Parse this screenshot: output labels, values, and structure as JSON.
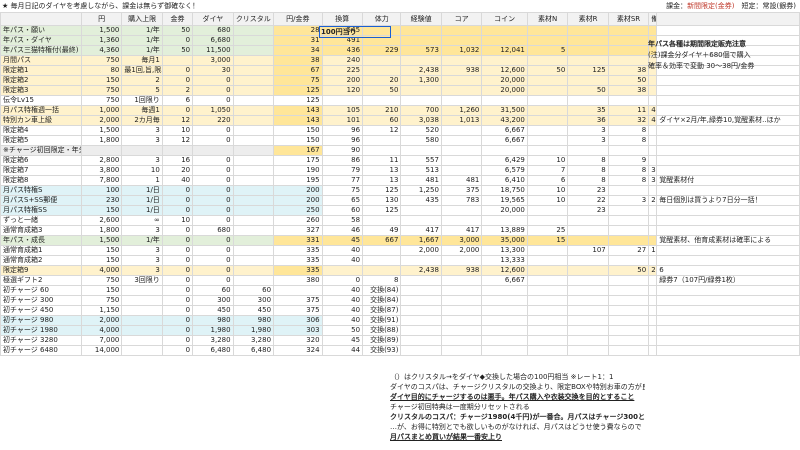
{
  "topbar": {
    "title": "★ 毎月日記のダイヤを考慮しながら、課金は無らず御確なく！",
    "right_prefix": "課金：",
    "right_mid": "新間限定(金券)",
    "right_suffix": "　短定：常設(銀券)"
  },
  "cell_b100": "100円当り",
  "headers": [
    "",
    "円",
    "購入上限",
    "金券",
    "ダイヤ",
    "クリスタル",
    "円/金券",
    "換算",
    "体力",
    "経験値",
    "コア",
    "コイン",
    "素材N",
    "素材R",
    "素材SR",
    "備考"
  ],
  "rows": [
    {
      "cells": [
        "年パス・願い",
        "1,500",
        "1/年",
        "50",
        "680",
        "",
        "28",
        "545",
        "",
        "",
        "",
        "",
        "",
        "",
        "",
        "",
        ""
      ],
      "cls": "g"
    },
    {
      "cells": [
        "年パス・ダイヤ",
        "1,360",
        "1/年",
        "0",
        "6,680",
        "",
        "31",
        "491",
        "",
        "",
        "",
        "",
        "",
        "",
        "",
        "",
        ""
      ],
      "cls": "g"
    },
    {
      "cells": [
        "年パス三猫特権付(最終)",
        "4,360",
        "1/年",
        "50",
        "11,500",
        "",
        "34",
        "436",
        "229",
        "573",
        "1,032",
        "12,041",
        "5",
        "",
        "",
        "",
        ""
      ],
      "cls": "g"
    },
    {
      "cells": [
        "月間パス",
        "750",
        "毎月1",
        "",
        "3,000",
        "",
        "38",
        "240",
        "",
        "",
        "",
        "",
        "",
        "",
        "",
        "",
        ""
      ],
      "cls": "y"
    },
    {
      "cells": [
        "限定箱1",
        "80",
        "最1回,旨,限5",
        "0",
        "30",
        "",
        "67",
        "225",
        "",
        "2,438",
        "938",
        "12,600",
        "50",
        "125",
        "38",
        "",
        ""
      ],
      "cls": "y"
    },
    {
      "cells": [
        "限定箱2",
        "150",
        "2",
        "0",
        "0",
        "",
        "75",
        "200",
        "20",
        "1,300",
        "",
        "20,000",
        "",
        "",
        "50",
        "",
        ""
      ],
      "cls": "y"
    },
    {
      "cells": [
        "限定箱3",
        "750",
        "5",
        "2",
        "0",
        "",
        "125",
        "120",
        "50",
        "",
        "",
        "20,000",
        "",
        "50",
        "38",
        "",
        ""
      ],
      "cls": "y"
    },
    {
      "cells": [
        "伝令Lv15",
        "750",
        "1回限り",
        "6",
        "0",
        "",
        "125",
        "",
        "",
        "",
        "",
        "",
        "",
        "",
        "",
        "",
        ""
      ],
      "cls": ""
    },
    {
      "cells": [
        "月パス特権週一括",
        "1,000",
        "毎週1",
        "0",
        "1,050",
        "",
        "143",
        "105",
        "210",
        "700",
        "1,260",
        "31,500",
        "",
        "35",
        "11",
        "4",
        ""
      ],
      "cls": "y"
    },
    {
      "cells": [
        "特別カン車上級",
        "2,000",
        "2カ月毎",
        "12",
        "220",
        "",
        "143",
        "101",
        "60",
        "3,038",
        "1,013",
        "43,200",
        "",
        "36",
        "32",
        "47",
        "ダイヤ×2月/年,緑券10,覚醒素材..ほか"
      ],
      "cls": "y"
    },
    {
      "cells": [
        "限定箱4",
        "1,500",
        "3",
        "10",
        "0",
        "",
        "150",
        "96",
        "12",
        "520",
        "",
        "6,667",
        "",
        "3",
        "8",
        "",
        ""
      ],
      "cls": ""
    },
    {
      "cells": [
        "限定箱5",
        "1,800",
        "3",
        "12",
        "0",
        "",
        "150",
        "96",
        "",
        "580",
        "",
        "6,667",
        "",
        "3",
        "8",
        "",
        ""
      ],
      "cls": ""
    },
    {
      "cells": [
        "※チャージ初回限定・年分で獲得",
        "",
        "",
        "",
        "",
        "",
        "167",
        "90",
        "",
        "",
        "",
        "",
        "",
        "",
        "",
        "",
        ""
      ],
      "cls": "gr"
    },
    {
      "cells": [
        "限定箱6",
        "2,800",
        "3",
        "16",
        "0",
        "",
        "175",
        "86",
        "11",
        "557",
        "",
        "6,429",
        "10",
        "8",
        "9",
        "",
        ""
      ],
      "cls": ""
    },
    {
      "cells": [
        "限定箱7",
        "3,800",
        "10",
        "20",
        "0",
        "",
        "190",
        "79",
        "13",
        "513",
        "",
        "6,579",
        "7",
        "8",
        "8",
        "3",
        ""
      ],
      "cls": ""
    },
    {
      "cells": [
        "限定箱8",
        "7,800",
        "1",
        "40",
        "0",
        "",
        "195",
        "77",
        "13",
        "481",
        "481",
        "6,410",
        "6",
        "8",
        "8",
        "3",
        "覚醒素材付"
      ],
      "cls": ""
    },
    {
      "cells": [
        "月パス特権S",
        "100",
        "1/日",
        "0",
        "0",
        "",
        "200",
        "75",
        "125",
        "1,250",
        "375",
        "18,750",
        "10",
        "23",
        "",
        "",
        ""
      ],
      "cls": "lb"
    },
    {
      "cells": [
        "月パスS+SS郵便",
        "230",
        "1/日",
        "0",
        "0",
        "",
        "200",
        "65",
        "130",
        "435",
        "783",
        "19,565",
        "10",
        "22",
        "3",
        "2",
        "毎日個別は買うより7日分一括！"
      ],
      "cls": "lb"
    },
    {
      "cells": [
        "月パス特権SS",
        "150",
        "1/日",
        "0",
        "0",
        "",
        "250",
        "60",
        "125",
        "",
        "",
        "20,000",
        "",
        "23",
        "",
        "",
        ""
      ],
      "cls": "lb"
    },
    {
      "cells": [
        "ずっと一緒",
        "2,600",
        "∞",
        "10",
        "0",
        "",
        "260",
        "58",
        "",
        "",
        "",
        "",
        "",
        "",
        "",
        "",
        ""
      ],
      "cls": ""
    },
    {
      "cells": [
        "通常育成箱3",
        "1,800",
        "3",
        "0",
        "680",
        "",
        "327",
        "46",
        "49",
        "417",
        "417",
        "13,889",
        "25",
        "",
        "",
        "",
        ""
      ],
      "cls": ""
    },
    {
      "cells": [
        "年パス・成長",
        "1,500",
        "1/年",
        "0",
        "0",
        "",
        "331",
        "45",
        "667",
        "1,667",
        "3,000",
        "35,000",
        "15",
        "",
        "",
        "",
        "覚醒素材、他育成素材は確率による"
      ],
      "cls": "g"
    },
    {
      "cells": [
        "通常育成箱1",
        "150",
        "3",
        "0",
        "0",
        "",
        "335",
        "40",
        "",
        "2,000",
        "2,000",
        "13,300",
        "",
        "107",
        "27",
        "11",
        ""
      ],
      "cls": ""
    },
    {
      "cells": [
        "通常育成箱2",
        "150",
        "3",
        "0",
        "0",
        "",
        "335",
        "40",
        "",
        "",
        "",
        "13,333",
        "",
        "",
        "",
        "",
        ""
      ],
      "cls": ""
    },
    {
      "cells": [
        "限定箱9",
        "4,000",
        "3",
        "0",
        "0",
        "",
        "335",
        "",
        "",
        "2,438",
        "938",
        "12,600",
        "",
        "",
        "50",
        "20",
        "6"
      ],
      "cls": "y"
    },
    {
      "cells": [
        "極選ギフト2",
        "750",
        "3回限り",
        "0",
        "0",
        "",
        "380",
        "0",
        "8",
        "",
        "",
        "6,667",
        "",
        "",
        "",
        "",
        "緑券7（107円/緑券1枚）"
      ],
      "cls": ""
    },
    {
      "cells": [
        "初チャージ 60",
        "150",
        "",
        "0",
        "60",
        "60",
        "",
        "40",
        "交換(84)",
        "",
        "",
        "",
        "",
        "",
        "",
        "",
        ""
      ],
      "cls": ""
    },
    {
      "cells": [
        "初チャージ 300",
        "750",
        "",
        "0",
        "300",
        "300",
        "375",
        "40",
        "交換(84)",
        "",
        "",
        "",
        "",
        "",
        "",
        "",
        ""
      ],
      "cls": ""
    },
    {
      "cells": [
        "初チャージ 450",
        "1,150",
        "",
        "0",
        "450",
        "450",
        "375",
        "40",
        "交換(87)",
        "",
        "",
        "",
        "",
        "",
        "",
        "",
        ""
      ],
      "cls": ""
    },
    {
      "cells": [
        "初チャージ 980",
        "2,000",
        "",
        "0",
        "980",
        "980",
        "306",
        "40",
        "交換(91)",
        "",
        "",
        "",
        "",
        "",
        "",
        "",
        ""
      ],
      "cls": "lb"
    },
    {
      "cells": [
        "初チャージ 1980",
        "4,000",
        "",
        "0",
        "1,980",
        "1,980",
        "303",
        "50",
        "交換(88)",
        "",
        "",
        "",
        "",
        "",
        "",
        "",
        ""
      ],
      "cls": "lb"
    },
    {
      "cells": [
        "初チャージ 3280",
        "7,000",
        "",
        "0",
        "3,280",
        "3,280",
        "320",
        "45",
        "交換(89)",
        "",
        "",
        "",
        "",
        "",
        "",
        "",
        ""
      ],
      "cls": ""
    },
    {
      "cells": [
        "初チャージ 6480",
        "14,000",
        "",
        "0",
        "6,480",
        "6,480",
        "324",
        "44",
        "交換(93)",
        "",
        "",
        "",
        "",
        "",
        "",
        "",
        ""
      ],
      "cls": ""
    }
  ],
  "notes": {
    "line1": "年パス各種は期間限定販売注意",
    "line2": "(注)課金分ダイヤ＋680個で購入",
    "line3": "確率＆効率で変動 30〜38円/金券"
  },
  "panel": {
    "l1": "（）はクリスタル→をダイヤ◆交換した場合の100円相当 ※レート1：1",
    "l2": "ダイヤのコスパは、チャージクリスタルの交換より、限定BOXや特別お車の方が良い",
    "l3": "ダイヤ目的にチャージするのは悪手。年パス購入や衣装交換を目的とすること",
    "l4": "チャージ初回特典は一度期分リセットされる",
    "l5": "クリスタルのコスパ：チャージ1980(4千円)が一番合。月パスはチャージ300と同率",
    "l6": "…が、お得に特別とでも欲しいものがなければ、月パスはどうせ使う費ならので",
    "l7": "月パスまとめ買いが結果一番安上り"
  }
}
